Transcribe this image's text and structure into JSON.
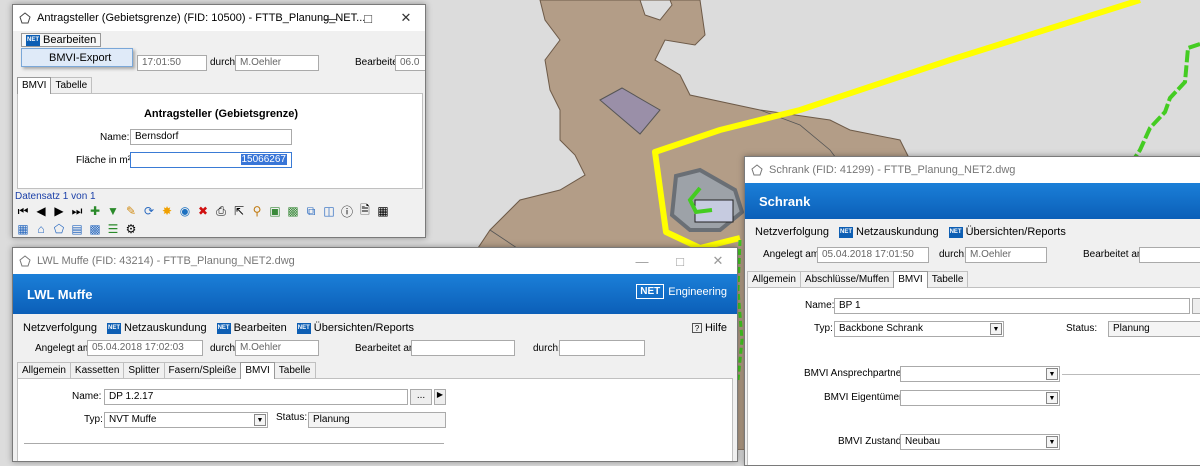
{
  "win1": {
    "title": "Antragsteller (Gebietsgrenze) (FID: 10500) - FTTB_Planung_NET...",
    "menu_label": "Bearbeiten",
    "dropdown_item": "BMVI-Export",
    "angelegt_value": "17:01:50",
    "durch_label": "durch:",
    "durch_value": "M.Oehler",
    "bearbeitet_label": "Bearbeitet am:",
    "bearbeitet_value": "06.0",
    "tabs": [
      "BMVI",
      "Tabelle"
    ],
    "panel_title": "Antragsteller (Gebietsgrenze)",
    "name_label": "Name:",
    "name_value": "Bernsdorf",
    "flaeche_label": "Fläche in m²:",
    "flaeche_value": "15066267",
    "record_label": "Datensatz 1 von 1"
  },
  "win2": {
    "title": "LWL Muffe (FID: 43214) - FTTB_Planung_NET2.dwg",
    "banner": "LWL Muffe",
    "logo_net": "NET",
    "logo_text": "Engineering",
    "menu": [
      "Netzverfolgung",
      "Netzauskundung",
      "Bearbeiten",
      "Übersichten/Reports"
    ],
    "help": "Hilfe",
    "angelegt_label": "Angelegt am:",
    "angelegt_value": "05.04.2018 17:02:03",
    "durch_label": "durch:",
    "durch_value": "M.Oehler",
    "bearbeitet_label": "Bearbeitet am:",
    "durch2_label": "durch:",
    "tabs": [
      "Allgemein",
      "Kassetten",
      "Splitter",
      "Fasern/Spleiße",
      "BMVI",
      "Tabelle"
    ],
    "name_label": "Name:",
    "name_value": "DP 1.2.17",
    "ellipsis": "...",
    "typ_label": "Typ:",
    "typ_value": "NVT Muffe",
    "status_label": "Status:",
    "status_value": "Planung"
  },
  "win3": {
    "title": "Schrank (FID: 41299) - FTTB_Planung_NET2.dwg",
    "banner": "Schrank",
    "menu": [
      "Netzverfolgung",
      "Netzauskundung",
      "Übersichten/Reports"
    ],
    "angelegt_label": "Angelegt am:",
    "angelegt_value": "05.04.2018 17:01:50",
    "durch_label": "durch:",
    "durch_value": "M.Oehler",
    "bearbeitet_label": "Bearbeitet am:",
    "tabs": [
      "Allgemein",
      "Abschlüsse/Muffen",
      "BMVI",
      "Tabelle"
    ],
    "name_label": "Name:",
    "name_value": "BP 1",
    "typ_label": "Typ:",
    "typ_value": "Backbone Schrank",
    "status_label": "Status:",
    "status_value": "Planung",
    "ansprech_label": "BMVI Ansprechpartner:",
    "eigentuemer_label": "BMVI Eigentümer:",
    "zustand_label": "BMVI Zustand:",
    "zustand_value": "Neubau"
  },
  "colors": {
    "map_background": "#dcdcdc",
    "region_fill": "#b39d87",
    "boundary_line": "#ffff00",
    "cable_line": "#44cc22",
    "banner_blue": "#0b5fb8"
  }
}
